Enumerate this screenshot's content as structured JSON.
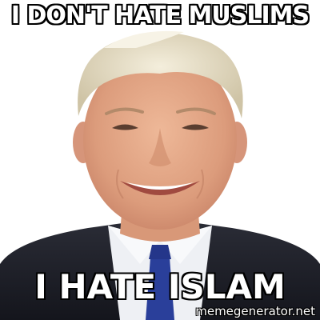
{
  "meme": {
    "top_text": "I DON'T HATE MUSLIMS",
    "bottom_text": "I HATE ISLAM",
    "watermark": "memegenerator.net"
  },
  "colors": {
    "background": "#ffffff",
    "caption_fill": "#ffffff",
    "caption_stroke": "#000000",
    "suit": "#1c1e28",
    "shirt": "#eef0f4",
    "tie": "#2a3f9a",
    "hair": "#e4dcc4",
    "skin": "#e2a888"
  }
}
